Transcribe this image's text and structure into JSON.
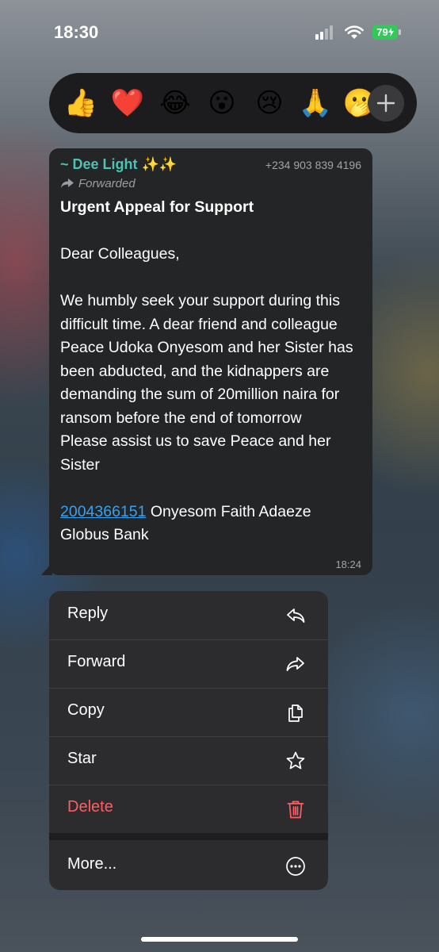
{
  "status_bar": {
    "time": "18:30",
    "battery": "79"
  },
  "reactions": [
    {
      "emoji": "👍",
      "name": "thumbs-up"
    },
    {
      "emoji": "❤️",
      "name": "red-heart"
    },
    {
      "emoji": "😂",
      "name": "tears-of-joy"
    },
    {
      "emoji": "😮",
      "name": "surprised"
    },
    {
      "emoji": "😢",
      "name": "crying"
    },
    {
      "emoji": "🙏",
      "name": "folded-hands"
    },
    {
      "emoji": "🫢",
      "name": "hand-over-mouth"
    }
  ],
  "message": {
    "sender": "~ Dee Light ✨✨",
    "phone": "+234 903 839 4196",
    "forwarded_label": "Forwarded",
    "title": "Urgent Appeal for Support",
    "greeting": "Dear Colleagues,",
    "body": "We humbly seek your support during this difficult time. A dear friend and colleague Peace Udoka Onyesom and her Sister has been abducted, and the kidnappers are demanding the sum of 20million naira for ransom before the end of tomorrow",
    "plea": "Please assist us to save Peace and her Sister",
    "account_number": "2004366151",
    "account_name": " Onyesom Faith Adaeze",
    "bank": "Globus Bank",
    "time": "18:24"
  },
  "menu": {
    "reply": "Reply",
    "forward": "Forward",
    "copy": "Copy",
    "star": "Star",
    "delete": "Delete",
    "more": "More..."
  },
  "colors": {
    "sender": "#4dc3b3",
    "link": "#3aa0f0",
    "delete": "#ff5e63",
    "battery": "#34c759"
  }
}
